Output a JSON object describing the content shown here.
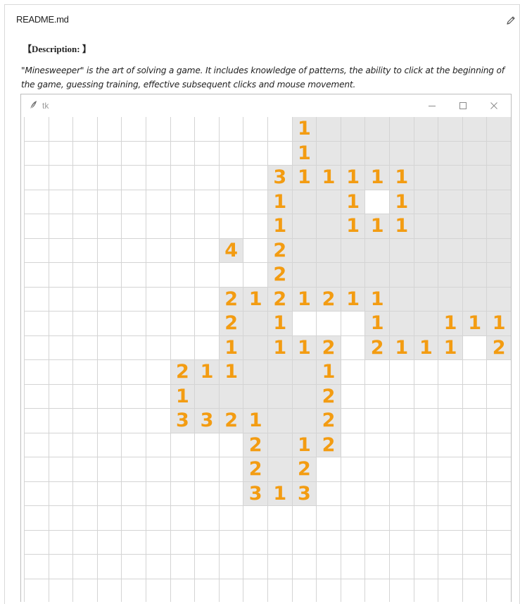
{
  "readme": {
    "filename": "README.md"
  },
  "description": {
    "heading": "【Description: 】",
    "text": "\"Minesweeper\" is the art of solving a game. It includes knowledge of patterns, the ability to click at the beginning of the game, guessing training, effective subsequent clicks and mouse movement."
  },
  "window": {
    "title": "tk",
    "minimize_label": "—",
    "maximize_label": "☐",
    "close_label": "✕"
  },
  "board": {
    "columns": 20,
    "rows": 20,
    "number_color": "#f39c12",
    "open_color": "#e6e6e6",
    "hidden_color": "#ffffff",
    "cells": [
      "...........1OOOOOOOO",
      "...........1OOOOOOOO",
      "..........311111OOOO",
      "..........1OO1.1OOOO",
      "..........1OO111OOOO",
      "........4.2OOOOOOOOO",
      "..........2OOOOOOOOO",
      "........2121211OOOOO",
      "........2O1...1OO111",
      "........1O112.2111.21",
      "......211OOO1.......",
      "......1OOOOO2.......",
      "......3321OO2.......",
      ".........2O12.......",
      ".........2O2........",
      ".........313........",
      "....................",
      "....................",
      "....................",
      "...................."
    ]
  }
}
